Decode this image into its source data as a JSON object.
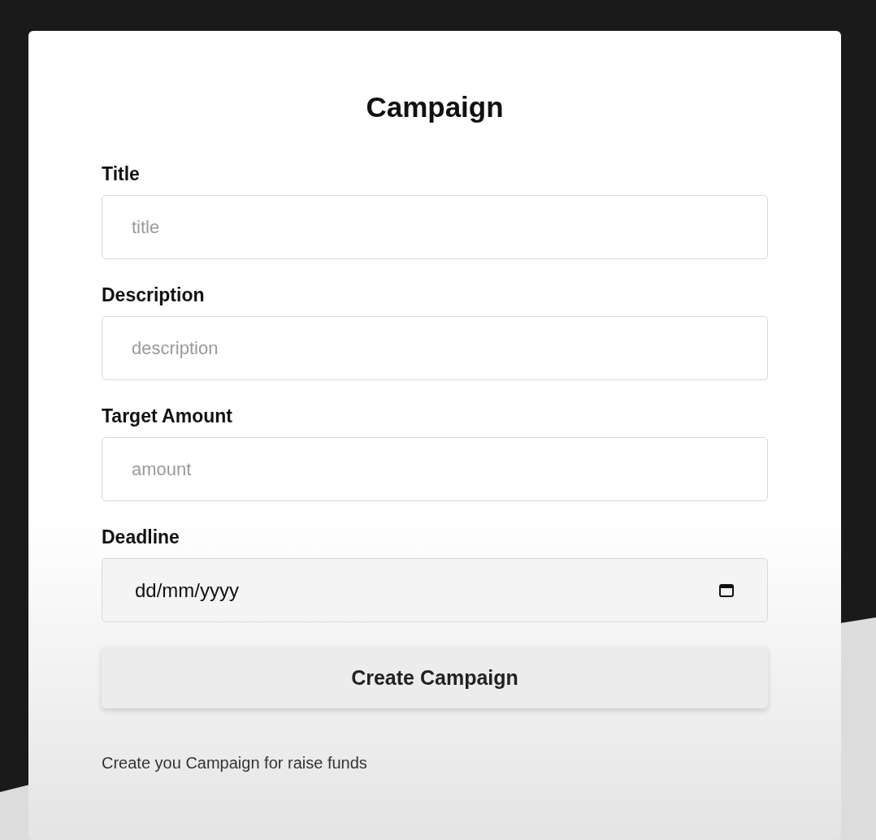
{
  "form": {
    "title": "Campaign",
    "fields": [
      {
        "label": "Title",
        "kind": "text",
        "placeholder": "title"
      },
      {
        "label": "Description",
        "kind": "text",
        "placeholder": "description"
      },
      {
        "label": "Target Amount",
        "kind": "text",
        "placeholder": "amount"
      },
      {
        "label": "Deadline",
        "kind": "date",
        "format": "dd/mm/yyyy"
      }
    ],
    "submit_button": "Create Campaign",
    "footnote": "Create you Campaign for raise funds"
  }
}
